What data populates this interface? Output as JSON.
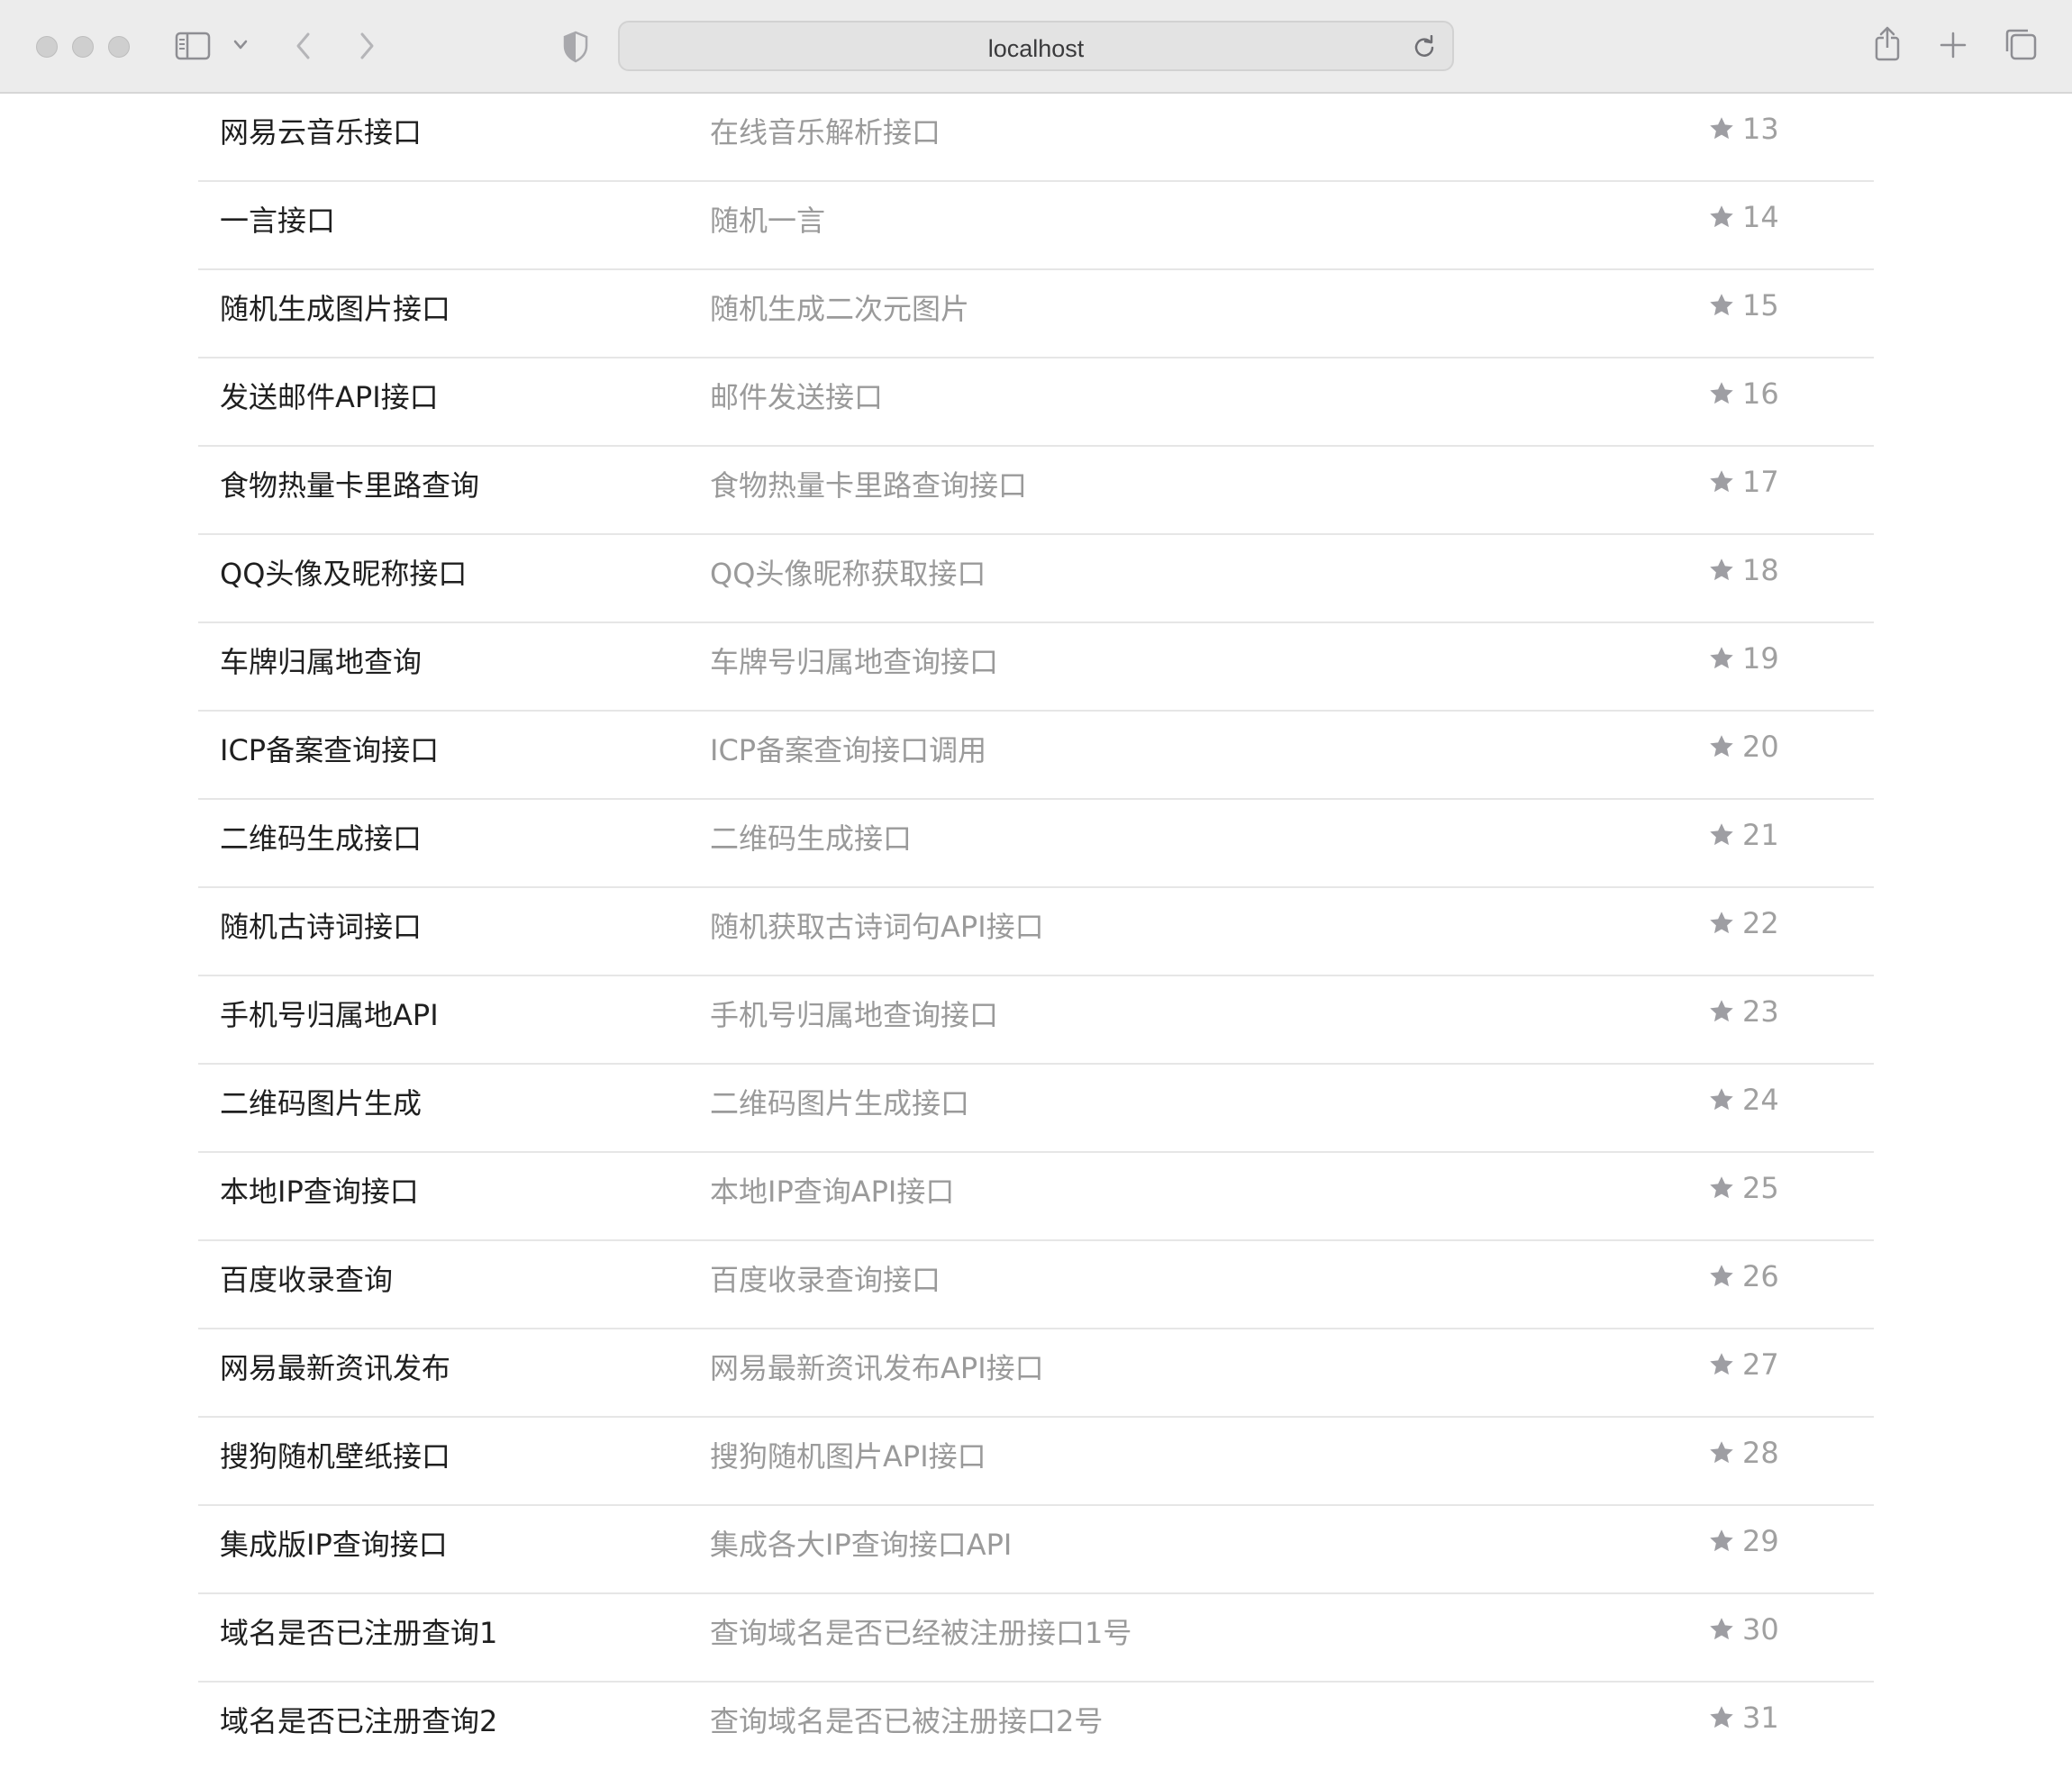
{
  "browser": {
    "url": "localhost"
  },
  "rows": [
    {
      "name": "网易云音乐接口",
      "desc": "在线音乐解析接口",
      "stars": "13"
    },
    {
      "name": "一言接口",
      "desc": "随机一言",
      "stars": "14"
    },
    {
      "name": "随机生成图片接口",
      "desc": "随机生成二次元图片",
      "stars": "15"
    },
    {
      "name": "发送邮件API接口",
      "desc": "邮件发送接口",
      "stars": "16"
    },
    {
      "name": "食物热量卡里路查询",
      "desc": "食物热量卡里路查询接口",
      "stars": "17"
    },
    {
      "name": "QQ头像及昵称接口",
      "desc": "QQ头像昵称获取接口",
      "stars": "18"
    },
    {
      "name": "车牌归属地查询",
      "desc": "车牌号归属地查询接口",
      "stars": "19"
    },
    {
      "name": "ICP备案查询接口",
      "desc": "ICP备案查询接口调用",
      "stars": "20"
    },
    {
      "name": "二维码生成接口",
      "desc": "二维码生成接口",
      "stars": "21"
    },
    {
      "name": "随机古诗词接口",
      "desc": "随机获取古诗词句API接口",
      "stars": "22"
    },
    {
      "name": "手机号归属地API",
      "desc": "手机号归属地查询接口",
      "stars": "23"
    },
    {
      "name": "二维码图片生成",
      "desc": "二维码图片生成接口",
      "stars": "24"
    },
    {
      "name": "本地IP查询接口",
      "desc": "本地IP查询API接口",
      "stars": "25"
    },
    {
      "name": "百度收录查询",
      "desc": "百度收录查询接口",
      "stars": "26"
    },
    {
      "name": "网易最新资讯发布",
      "desc": "网易最新资讯发布API接口",
      "stars": "27"
    },
    {
      "name": "搜狗随机壁纸接口",
      "desc": "搜狗随机图片API接口",
      "stars": "28"
    },
    {
      "name": "集成版IP查询接口",
      "desc": "集成各大IP查询接口API",
      "stars": "29"
    },
    {
      "name": "域名是否已注册查询1",
      "desc": "查询域名是否已经被注册接口1号",
      "stars": "30"
    },
    {
      "name": "域名是否已注册查询2",
      "desc": "查询域名是否已被注册接口2号",
      "stars": "31"
    }
  ]
}
